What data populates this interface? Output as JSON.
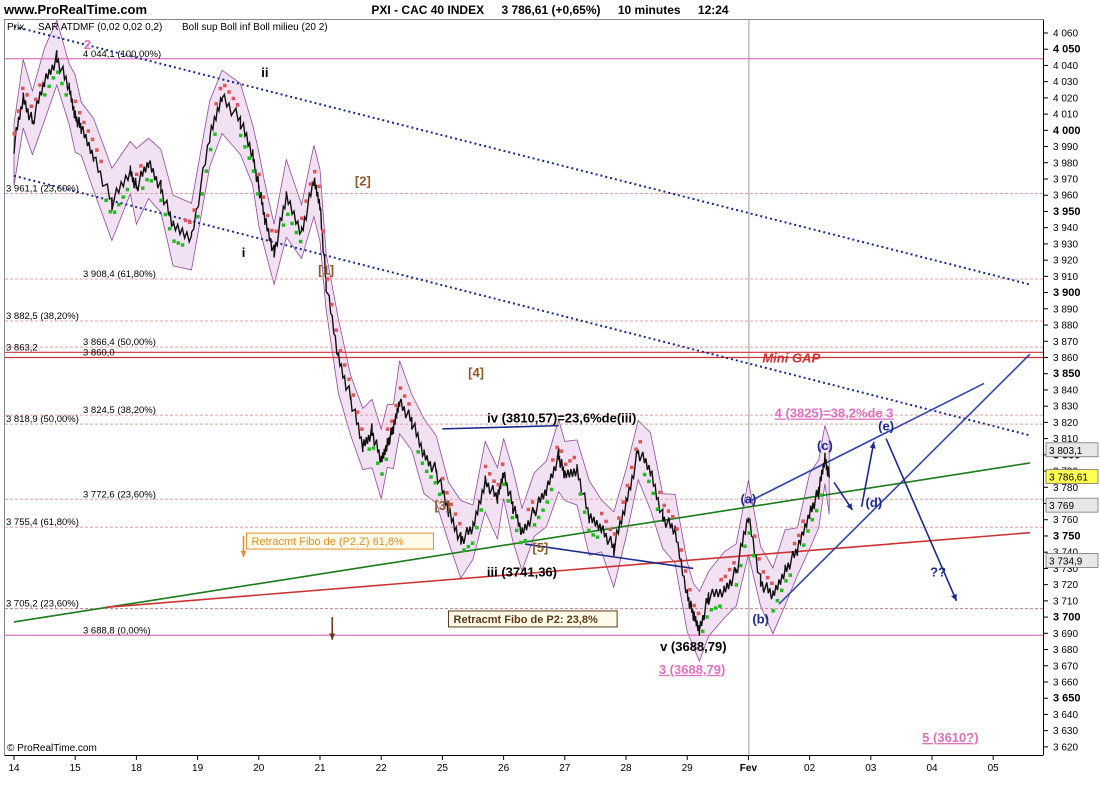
{
  "header": {
    "site": "www.ProRealTime.com",
    "ticker": "PXI - CAC 40 INDEX",
    "last": "3 786,61 (+0,65%)",
    "interval": "10 minutes",
    "time": "12:24"
  },
  "legend": {
    "prix": "Prix",
    "sar": "SAR ATDMF (0,02 0,02 0,2)",
    "boll": "Boll sup Boll inf Boll milieu (20 2)"
  },
  "copyright": "© ProRealTime.com",
  "colors": {
    "sar_up": "#22bb22",
    "sar_down": "#dd5555",
    "boll_fill": "#f0dcf0",
    "boll_line": "#7a2a8a",
    "trend": "#1a2a8a",
    "green_line": "#1a7a1a",
    "red_line": "#cc3333",
    "fib_pink": "#e070c0"
  },
  "chart_data": {
    "type": "line",
    "ylim": [
      3615,
      4068
    ],
    "y_ticks": [
      3620,
      3630,
      3640,
      3650,
      3660,
      3670,
      3680,
      3690,
      3700,
      3710,
      3720,
      3730,
      3740,
      3750,
      3760,
      3770,
      3780,
      3790,
      3800,
      3810,
      3820,
      3830,
      3840,
      3850,
      3860,
      3870,
      3880,
      3890,
      3900,
      3910,
      3920,
      3930,
      3940,
      3950,
      3960,
      3970,
      3980,
      3990,
      4000,
      4010,
      4020,
      4030,
      4040,
      4050,
      4060
    ],
    "y_tick_labels": [
      "3 620",
      "3 630",
      "3 640",
      "3 650",
      "3 660",
      "3 670",
      "3 680",
      "3 690",
      "3 700",
      "3 710",
      "3 720",
      "3 730",
      "3 740",
      "3 750",
      "3 760",
      "3 770",
      "3 780",
      "3 790",
      "3 800",
      "3 810",
      "3 820",
      "3 830",
      "3 840",
      "3 850",
      "3 860",
      "3 870",
      "3 880",
      "3 890",
      "3 900",
      "3 910",
      "3 920",
      "3 930",
      "3 940",
      "3 950",
      "3 960",
      "3 970",
      "3 980",
      "3 990",
      "4 000",
      "4 010",
      "4 020",
      "4 030",
      "4 040",
      "4 050",
      "4 060"
    ],
    "y_bold_ticks": [
      3650,
      3700,
      3750,
      3800,
      3850,
      3900,
      3950,
      4000,
      4050
    ],
    "x_sessions": [
      "14",
      "15",
      "18",
      "19",
      "20",
      "21",
      "22",
      "25",
      "26",
      "27",
      "28",
      "29",
      "Fev",
      "02",
      "03",
      "04",
      "05"
    ],
    "price_series": {
      "name": "Prix",
      "x": [
        0,
        0.15,
        0.3,
        0.5,
        0.7,
        0.9,
        1.0,
        1.1,
        1.3,
        1.6,
        1.9,
        2.0,
        2.2,
        2.4,
        2.6,
        2.9,
        3.2,
        3.4,
        3.7,
        3.9,
        4.0,
        4.1,
        4.25,
        4.45,
        4.7,
        4.9,
        5.0,
        5.1,
        5.3,
        5.5,
        5.7,
        5.85,
        6.0,
        6.1,
        6.2,
        6.3,
        6.5,
        6.7,
        6.9,
        7.1,
        7.3,
        7.5,
        7.7,
        7.9,
        8.0,
        8.15,
        8.3,
        8.5,
        8.7,
        8.9,
        9.0,
        9.2,
        9.4,
        9.6,
        9.8,
        10.0,
        10.2,
        10.4,
        10.6,
        10.8,
        11.0,
        11.1,
        11.2,
        11.35,
        11.6,
        11.8,
        12.0,
        12.2,
        12.4,
        12.6,
        12.8,
        13.0,
        13.15,
        13.25,
        13.32
      ],
      "y": [
        3990,
        4020,
        4005,
        4030,
        4045,
        4025,
        4010,
        4000,
        3985,
        3955,
        3975,
        3965,
        3980,
        3965,
        3940,
        3935,
        3995,
        4022,
        4005,
        3985,
        3965,
        3945,
        3925,
        3958,
        3938,
        3968,
        3955,
        3905,
        3860,
        3835,
        3805,
        3815,
        3795,
        3808,
        3815,
        3834,
        3820,
        3800,
        3790,
        3765,
        3748,
        3754,
        3785,
        3772,
        3790,
        3768,
        3752,
        3765,
        3778,
        3800,
        3786,
        3792,
        3760,
        3756,
        3742,
        3770,
        3802,
        3790,
        3762,
        3752,
        3715,
        3700,
        3693,
        3712,
        3716,
        3728,
        3762,
        3722,
        3712,
        3730,
        3740,
        3765,
        3777,
        3798,
        3787
      ]
    },
    "sar_up_segments": [
      [
        0.5,
        0.9
      ],
      [
        1.5,
        1.9
      ],
      [
        2.1,
        2.3
      ],
      [
        2.4,
        2.75
      ],
      [
        3.0,
        3.3
      ],
      [
        3.7,
        4.0
      ],
      [
        4.4,
        4.7
      ],
      [
        5.8,
        6.1
      ],
      [
        6.6,
        7.0
      ],
      [
        7.35,
        7.7
      ],
      [
        8.0,
        8.4
      ],
      [
        8.5,
        8.8
      ],
      [
        9.25,
        9.6
      ],
      [
        10.3,
        10.55
      ],
      [
        11.25,
        11.55
      ],
      [
        11.8,
        12.1
      ],
      [
        12.4,
        12.75
      ],
      [
        12.9,
        13.25
      ]
    ],
    "sar_down_segments": [
      [
        0.0,
        0.45
      ],
      [
        1.0,
        1.45
      ],
      [
        2.0,
        2.1
      ],
      [
        2.8,
        3.0
      ],
      [
        3.3,
        3.7
      ],
      [
        4.0,
        4.35
      ],
      [
        4.7,
        5.0
      ],
      [
        5.05,
        5.75
      ],
      [
        6.1,
        6.5
      ],
      [
        7.0,
        7.3
      ],
      [
        7.7,
        8.0
      ],
      [
        8.4,
        8.5
      ],
      [
        8.8,
        9.2
      ],
      [
        9.6,
        10.3
      ],
      [
        10.55,
        11.2
      ],
      [
        11.55,
        11.8
      ],
      [
        12.1,
        12.4
      ],
      [
        12.75,
        12.9
      ]
    ],
    "h_levels": [
      {
        "value": 4044.1,
        "label": "4 044,1 (100,00%)",
        "color": "#e070c0",
        "style": "solid"
      },
      {
        "value": 3961.1,
        "label": "3 961,1 (23,60%)",
        "color": "#e0a0a0",
        "style": "dash"
      },
      {
        "value": 3908.4,
        "label": "3 908,4 (61,80%)",
        "color": "#e0a0a0",
        "style": "dash"
      },
      {
        "value": 3882.5,
        "label": "3 882,5 (38,20%)",
        "color": "#e0a0a0",
        "style": "dash"
      },
      {
        "value": 3866.4,
        "label": "3 866,4 (50,00%)",
        "color": "#e0a0a0",
        "style": "dash"
      },
      {
        "value": 3863.2,
        "label": "3 863,2",
        "color": "#cc3333",
        "style": "solid"
      },
      {
        "value": 3860.0,
        "label": "3 860,0",
        "color": "#cc3333",
        "style": "solid"
      },
      {
        "value": 3824.5,
        "label": "3 824,5 (38,20%)",
        "color": "#e0a0a0",
        "style": "dash"
      },
      {
        "value": 3818.9,
        "label": "3 818,9 (50,00%)",
        "color": "#e0a0a0",
        "style": "dash"
      },
      {
        "value": 3772.6,
        "label": "3 772,6 (23,60%)",
        "color": "#e0a0a0",
        "style": "dash"
      },
      {
        "value": 3755.4,
        "label": "3 755,4 (61,80%)",
        "color": "#e0a0a0",
        "style": "dash"
      },
      {
        "value": 3705.2,
        "label": "3 705,2 (23,60%)",
        "color": "#c08080",
        "style": "dash"
      },
      {
        "value": 3688.8,
        "label": "3 688,8 (0,00%)",
        "color": "#e070c0",
        "style": "solid"
      }
    ],
    "price_tags": [
      {
        "value": 3803.1,
        "label": "3 803,1",
        "color": "#e8e8e8"
      },
      {
        "value": 3786.61,
        "label": "3 786,61",
        "color": "#ffff55"
      },
      {
        "value": 3769,
        "label": "3 769",
        "color": "#e8e8e8"
      },
      {
        "value": 3734.9,
        "label": "3 734,9",
        "color": "#e8e8e8"
      }
    ],
    "trend_lines": [
      {
        "name": "channel-top",
        "x1": 0,
        "y1": 4064,
        "x2": 16.6,
        "y2": 3905,
        "color": "#1a2a8a",
        "dash": true
      },
      {
        "name": "channel-bottom",
        "x1": 0,
        "y1": 3972,
        "x2": 16.6,
        "y2": 3812,
        "color": "#1a2a8a",
        "dash": true
      },
      {
        "name": "green-support",
        "x1": 0,
        "y1": 3697,
        "x2": 16.6,
        "y2": 3795,
        "color": "#1a7a1a",
        "dash": false
      },
      {
        "name": "red-support",
        "x1": 1.5,
        "y1": 3706,
        "x2": 16.6,
        "y2": 3752,
        "color": "#cc3333",
        "dash": false
      },
      {
        "name": "triangle-upper",
        "x1": 7.0,
        "y1": 3816,
        "x2": 8.9,
        "y2": 3818,
        "color": "#1a2a8a",
        "dash": false
      },
      {
        "name": "triangle-lower",
        "x1": 8.35,
        "y1": 3745,
        "x2": 11.1,
        "y2": 3730,
        "color": "#1a2a8a",
        "dash": false
      },
      {
        "name": "wedge-upper",
        "x1": 12.0,
        "y1": 3771,
        "x2": 15.85,
        "y2": 3844,
        "color": "#3344aa",
        "dash": false
      },
      {
        "name": "wedge-lower",
        "x1": 12.5,
        "y1": 3708,
        "x2": 16.6,
        "y2": 3862,
        "color": "#3344aa",
        "dash": false
      }
    ],
    "annotations": [
      {
        "text": "2",
        "x": 1.2,
        "y": 4050,
        "color": "#e070c0"
      },
      {
        "text": "ii",
        "x": 4.1,
        "y": 4033,
        "color": "#000000"
      },
      {
        "text": "[2]",
        "x": 5.7,
        "y": 3966,
        "color": "#8b5a2b"
      },
      {
        "text": "i",
        "x": 3.75,
        "y": 3922,
        "color": "#000000"
      },
      {
        "text": "[1]",
        "x": 5.1,
        "y": 3911,
        "color": "#8b5a2b"
      },
      {
        "text": "[4]",
        "x": 7.55,
        "y": 3848,
        "color": "#8b5a2b"
      },
      {
        "text": "iv (3810,57)=23,6%de(iii)",
        "x": 8.95,
        "y": 3820,
        "color": "#000000"
      },
      {
        "text": "[3]",
        "x": 7.0,
        "y": 3766,
        "color": "#8b5a2b"
      },
      {
        "text": "[5]",
        "x": 8.6,
        "y": 3740,
        "color": "#8b5a2b"
      },
      {
        "text": "iii (3741,36)",
        "x": 8.3,
        "y": 3725,
        "color": "#000000"
      },
      {
        "text": "v (3688,79)",
        "x": 11.1,
        "y": 3679,
        "color": "#000000"
      },
      {
        "text": "3 (3688,79)",
        "x": 11.08,
        "y": 3665,
        "color": "#e070c0"
      },
      {
        "text": "Mini GAP",
        "x": 12.7,
        "y": 3857,
        "color": "#cc3333"
      },
      {
        "text": "4 (3825)=38,2%de 3",
        "x": 13.4,
        "y": 3823,
        "color": "#e070c0"
      },
      {
        "text": "(c)",
        "x": 13.25,
        "y": 3803,
        "color": "#1a2a8a"
      },
      {
        "text": "(e)",
        "x": 14.25,
        "y": 3815,
        "color": "#1a2a8a"
      },
      {
        "text": "(a)",
        "x": 12.0,
        "y": 3770,
        "color": "#1a2a8a"
      },
      {
        "text": "(d)",
        "x": 14.05,
        "y": 3768,
        "color": "#1a2a8a"
      },
      {
        "text": "(b)",
        "x": 12.2,
        "y": 3696,
        "color": "#1a2a8a"
      },
      {
        "text": "??",
        "x": 15.1,
        "y": 3725,
        "color": "#1a2a8a"
      },
      {
        "text": "5 (3610?)",
        "x": 15.3,
        "y": 3623,
        "color": "#e070c0"
      }
    ],
    "boxes": [
      {
        "text": "Retracmt Fibo de (P2.Z) 61,8%",
        "x": 3.8,
        "y": 3745,
        "color": "#e09030"
      },
      {
        "text": "Retracmt Fibo de P2: 23,8%",
        "x": 7.1,
        "y": 3697,
        "color": "#5a3a1a"
      }
    ],
    "arrows": [
      {
        "x1": 3.75,
        "y1": 3750,
        "x2": 3.75,
        "y2": 3737,
        "color": "#e09030"
      },
      {
        "x1": 5.2,
        "y1": 3700,
        "x2": 5.2,
        "y2": 3686,
        "color": "#6a3a1a"
      },
      {
        "x1": 13.4,
        "y1": 3783,
        "x2": 13.7,
        "y2": 3766,
        "color": "#1a2a8a"
      },
      {
        "x1": 13.85,
        "y1": 3768,
        "x2": 14.05,
        "y2": 3808,
        "color": "#1a2a8a"
      },
      {
        "x1": 14.25,
        "y1": 3810,
        "x2": 15.4,
        "y2": 3710,
        "color": "#1a2a8a"
      }
    ]
  }
}
